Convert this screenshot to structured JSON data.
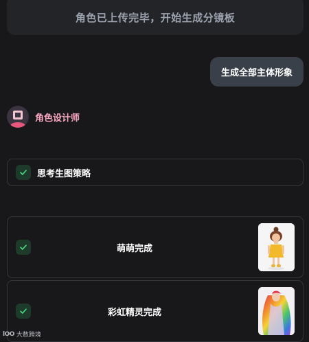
{
  "banner": {
    "text": "角色已上传完毕，开始生成分镜板"
  },
  "user_message": {
    "text": "生成全部主体形象"
  },
  "agent": {
    "name": "角色设计师"
  },
  "strategy": {
    "label": "思考生图策略"
  },
  "results": [
    {
      "label": "萌萌完成",
      "thumb_icon": "cartoon-girl-yellow-dress"
    },
    {
      "label": "彩虹精灵完成",
      "thumb_icon": "rainbow-hair-fairy"
    }
  ],
  "watermark": {
    "logo": "lOO",
    "text": "大数跨境"
  },
  "colors": {
    "background": "#18181b",
    "accent_pink": "#f8a5c0",
    "check_green": "#4ade80",
    "bubble": "#3a404a"
  }
}
